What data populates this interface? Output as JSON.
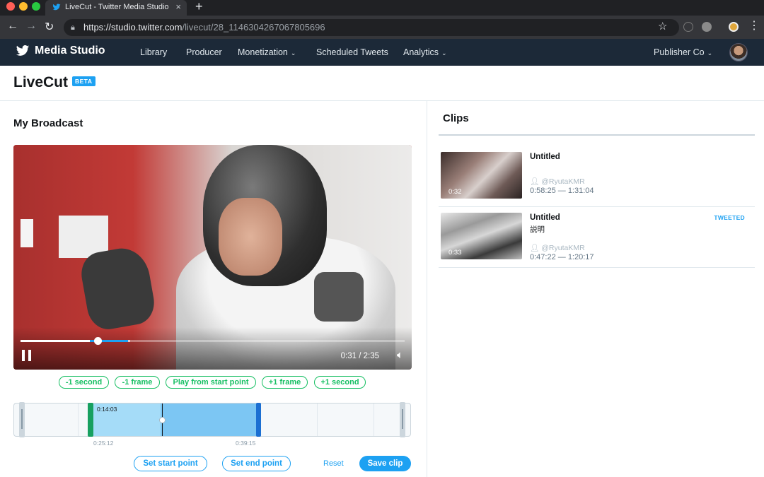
{
  "browser": {
    "tab_title": "LiveCut - Twitter Media Studio",
    "close_glyph": "×",
    "new_tab_glyph": "+",
    "url_host": "https://studio.twitter.com",
    "url_path": "/livecut/28_1146304267067805696"
  },
  "nav": {
    "brand": "Media Studio",
    "items": [
      {
        "label": "Library",
        "caret": ""
      },
      {
        "label": "Producer",
        "caret": ""
      },
      {
        "label": "Monetization",
        "caret": "⌄"
      },
      {
        "label": "Scheduled Tweets",
        "caret": ""
      },
      {
        "label": "Analytics",
        "caret": "⌄"
      }
    ],
    "account": "Publisher Co",
    "account_caret": "⌄"
  },
  "page": {
    "title": "LiveCut",
    "badge": "BETA"
  },
  "broadcast": {
    "heading": "My Broadcast",
    "current_time": "0:31",
    "duration": "2:35",
    "time_display": "0:31 / 2:35",
    "progress_fraction": 0.2,
    "buffered_fraction": 0.285,
    "clip_range_fraction": [
      0.18,
      0.28
    ]
  },
  "frame_controls": [
    "-1 second",
    "-1 frame",
    "Play from start point",
    "+1 frame",
    "+1 second"
  ],
  "timeline": {
    "selection_duration": "0:14:03",
    "start_tick": "0:25:12",
    "end_tick": "0:39:15"
  },
  "actions": {
    "set_start": "Set start point",
    "set_end": "Set end point",
    "reset": "Reset",
    "save": "Save clip"
  },
  "clips": {
    "heading": "Clips",
    "items": [
      {
        "title": "Untitled",
        "description": "",
        "duration": "0:32",
        "user": "@RyutaKMR",
        "range": "0:58:25 — 1:31:04",
        "status": ""
      },
      {
        "title": "Untitled",
        "description": "説明",
        "duration": "0:33",
        "user": "@RyutaKMR",
        "range": "0:47:22 — 1:20:17",
        "status": "TWEETED"
      }
    ]
  },
  "colors": {
    "twitter_blue": "#1da1f2",
    "nav_bg": "#1c2938",
    "green": "#17bf63"
  }
}
